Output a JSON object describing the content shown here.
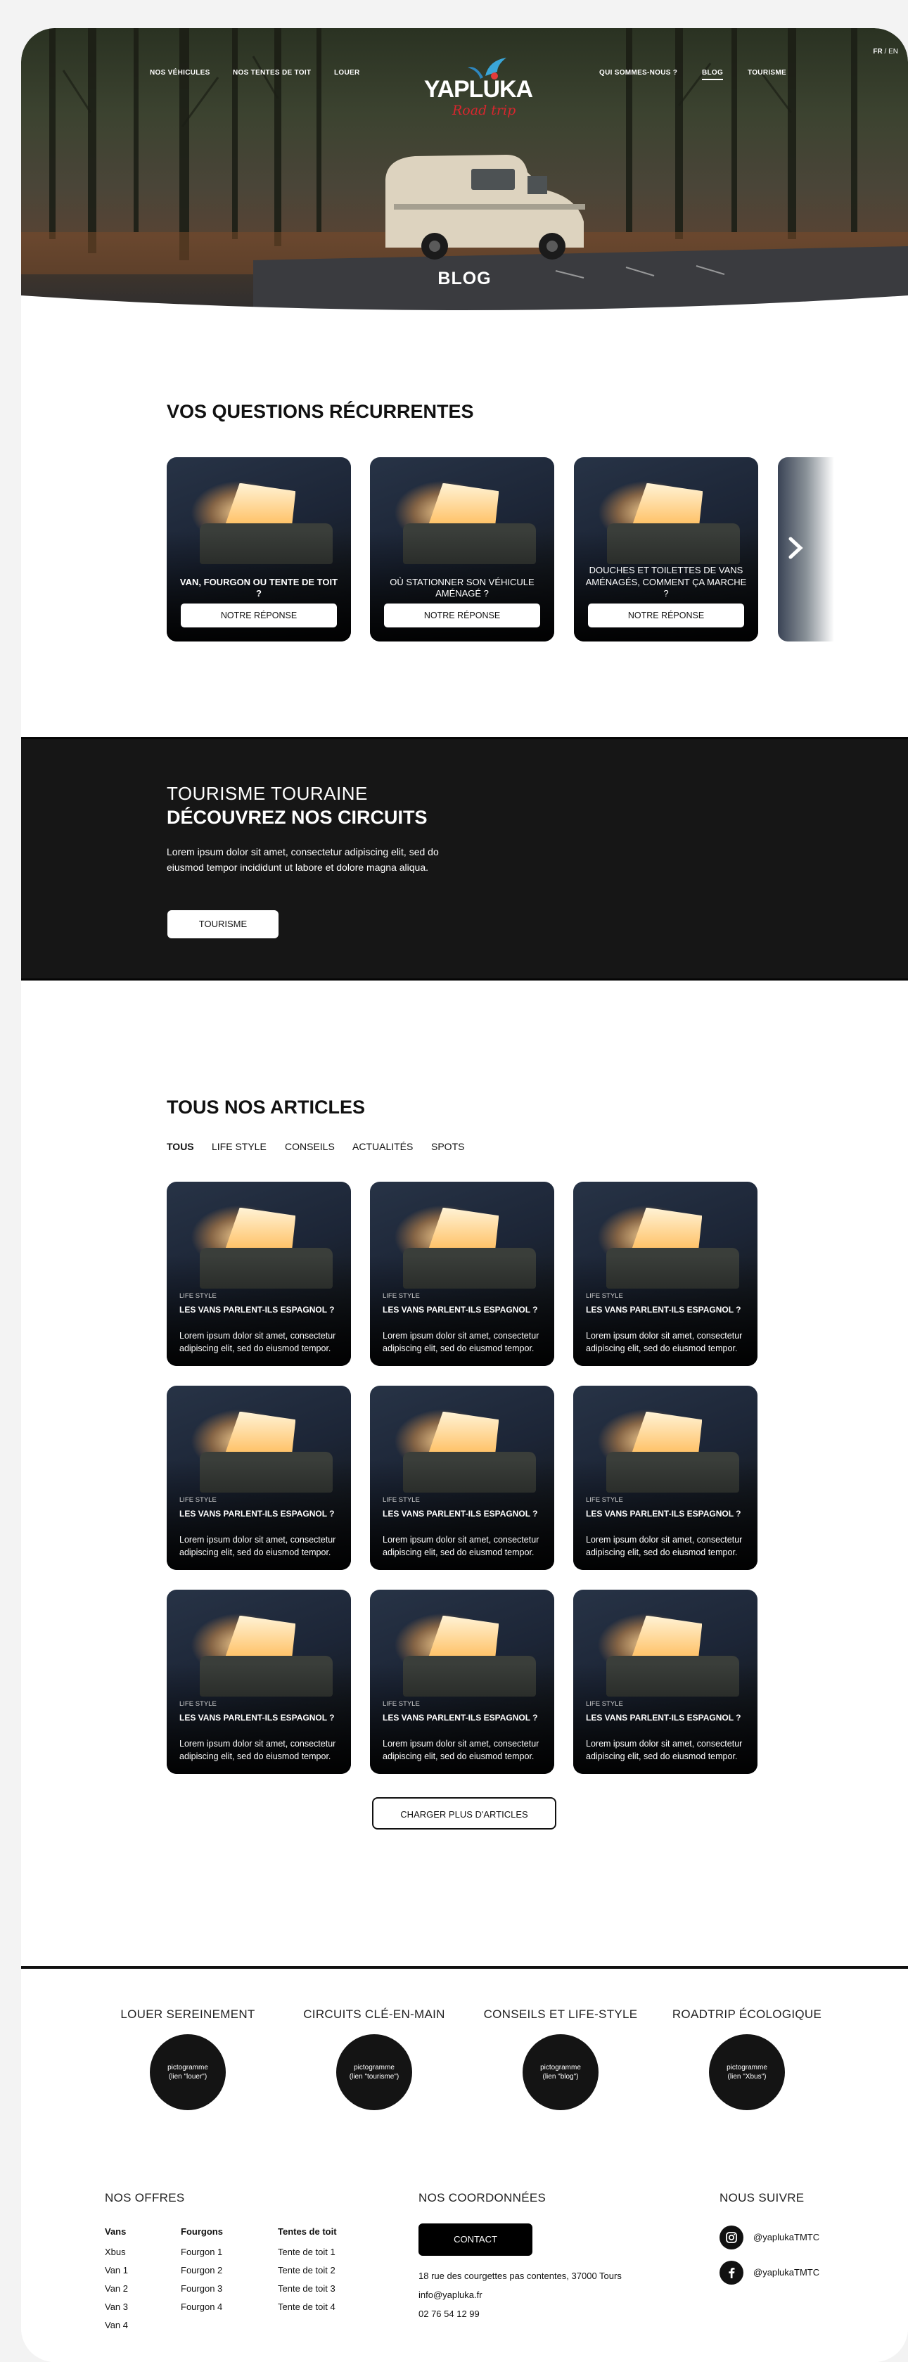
{
  "nav": {
    "left": [
      "NOS VÉHICULES",
      "NOS TENTES DE TOIT",
      "LOUER"
    ],
    "right": [
      "QUI SOMMES-NOUS ?",
      "BLOG",
      "TOURISME"
    ],
    "active": "BLOG",
    "lang_active": "FR",
    "lang_sep": "/",
    "lang_other": "EN"
  },
  "logo": {
    "brand": "YAPLUKA",
    "tagline": "Road trip"
  },
  "hero": {
    "title": "BLOG"
  },
  "faq": {
    "title": "VOS QUESTIONS RÉCURRENTES",
    "cards": [
      {
        "question": "VAN, FOURGON OU TENTE DE TOIT ?",
        "button": "NOTRE RÉPONSE"
      },
      {
        "question": "OÙ STATIONNER SON VÉHICULE AMÉNAGÉ ?",
        "button": "NOTRE RÉPONSE"
      },
      {
        "question": "DOUCHES ET TOILETTES DE VANS AMÉNAGÉS, COMMENT ÇA MARCHE ?",
        "button": "NOTRE RÉPONSE"
      }
    ],
    "next_icon": "chevron-right-icon"
  },
  "tourism": {
    "kicker": "TOURISME TOURAINE",
    "title": "DÉCOUVREZ NOS CIRCUITS",
    "text": "Lorem ipsum dolor sit amet, consectetur adipiscing elit, sed do eiusmod tempor incididunt ut labore et dolore magna aliqua.",
    "button": "TOURISME"
  },
  "articles": {
    "title": "TOUS NOS ARTICLES",
    "filters": [
      "TOUS",
      "LIFE STYLE",
      "CONSEILS",
      "ACTUALITÉS",
      "SPOTS"
    ],
    "active_filter": "TOUS",
    "items": [
      {
        "category": "LIFE STYLE",
        "title": "LES VANS PARLENT-ILS ESPAGNOL ?",
        "excerpt": "Lorem ipsum dolor sit amet, consectetur adipiscing elit, sed do eiusmod tempor."
      },
      {
        "category": "LIFE STYLE",
        "title": "LES VANS PARLENT-ILS ESPAGNOL ?",
        "excerpt": "Lorem ipsum dolor sit amet, consectetur adipiscing elit, sed do eiusmod tempor."
      },
      {
        "category": "LIFE STYLE",
        "title": "LES VANS PARLENT-ILS ESPAGNOL ?",
        "excerpt": "Lorem ipsum dolor sit amet, consectetur adipiscing elit, sed do eiusmod tempor."
      },
      {
        "category": "LIFE STYLE",
        "title": "LES VANS PARLENT-ILS ESPAGNOL ?",
        "excerpt": "Lorem ipsum dolor sit amet, consectetur adipiscing elit, sed do eiusmod tempor."
      },
      {
        "category": "LIFE STYLE",
        "title": "LES VANS PARLENT-ILS ESPAGNOL ?",
        "excerpt": "Lorem ipsum dolor sit amet, consectetur adipiscing elit, sed do eiusmod tempor."
      },
      {
        "category": "LIFE STYLE",
        "title": "LES VANS PARLENT-ILS ESPAGNOL ?",
        "excerpt": "Lorem ipsum dolor sit amet, consectetur adipiscing elit, sed do eiusmod tempor."
      },
      {
        "category": "LIFE STYLE",
        "title": "LES VANS PARLENT-ILS ESPAGNOL ?",
        "excerpt": "Lorem ipsum dolor sit amet, consectetur adipiscing elit, sed do eiusmod tempor."
      },
      {
        "category": "LIFE STYLE",
        "title": "LES VANS PARLENT-ILS ESPAGNOL ?",
        "excerpt": "Lorem ipsum dolor sit amet, consectetur adipiscing elit, sed do eiusmod tempor."
      },
      {
        "category": "LIFE STYLE",
        "title": "LES VANS PARLENT-ILS ESPAGNOL ?",
        "excerpt": "Lorem ipsum dolor sit amet, consectetur adipiscing elit, sed do eiusmod tempor."
      }
    ],
    "load_more": "CHARGER PLUS D'ARTICLES"
  },
  "services": [
    {
      "label": "LOUER SEREINEMENT",
      "icon_line1": "pictogramme",
      "icon_line2": "(lien \"louer\")"
    },
    {
      "label": "CIRCUITS CLÉ-EN-MAIN",
      "icon_line1": "pictogramme",
      "icon_line2": "(lien \"tourisme\")"
    },
    {
      "label": "CONSEILS ET LIFE-STYLE",
      "icon_line1": "pictogramme",
      "icon_line2": "(lien \"blog\")"
    },
    {
      "label": "ROADTRIP ÉCOLOGIQUE",
      "icon_line1": "pictogramme",
      "icon_line2": "(lien \"Xbus\")"
    }
  ],
  "footer": {
    "offers_title": "NOS OFFRES",
    "columns": [
      {
        "heading": "Vans",
        "items": [
          "Xbus",
          "Van 1",
          "Van 2",
          "Van 3",
          "Van 4"
        ]
      },
      {
        "heading": "Fourgons",
        "items": [
          "Fourgon 1",
          "Fourgon 2",
          "Fourgon 3",
          "Fourgon 4"
        ]
      },
      {
        "heading": "Tentes de toit",
        "items": [
          "Tente de toit 1",
          "Tente de toit 2",
          "Tente de toit 3",
          "Tente de toit 4"
        ]
      }
    ],
    "contact_title": "NOS COORDONNÉES",
    "contact_button": "CONTACT",
    "address": "18 rue des courgettes pas contentes, 37000 Tours",
    "email": "info@yapluka.fr",
    "phone": "02 76 54 12 99",
    "follow_title": "NOUS SUIVRE",
    "socials": [
      {
        "icon": "instagram-icon",
        "handle": "@yaplukaTMTC"
      },
      {
        "icon": "facebook-icon",
        "handle": "@yaplukaTMTC"
      }
    ]
  },
  "colors": {
    "accent_red": "#d8262e",
    "dark": "#161616",
    "background": "#f3f3f3"
  }
}
